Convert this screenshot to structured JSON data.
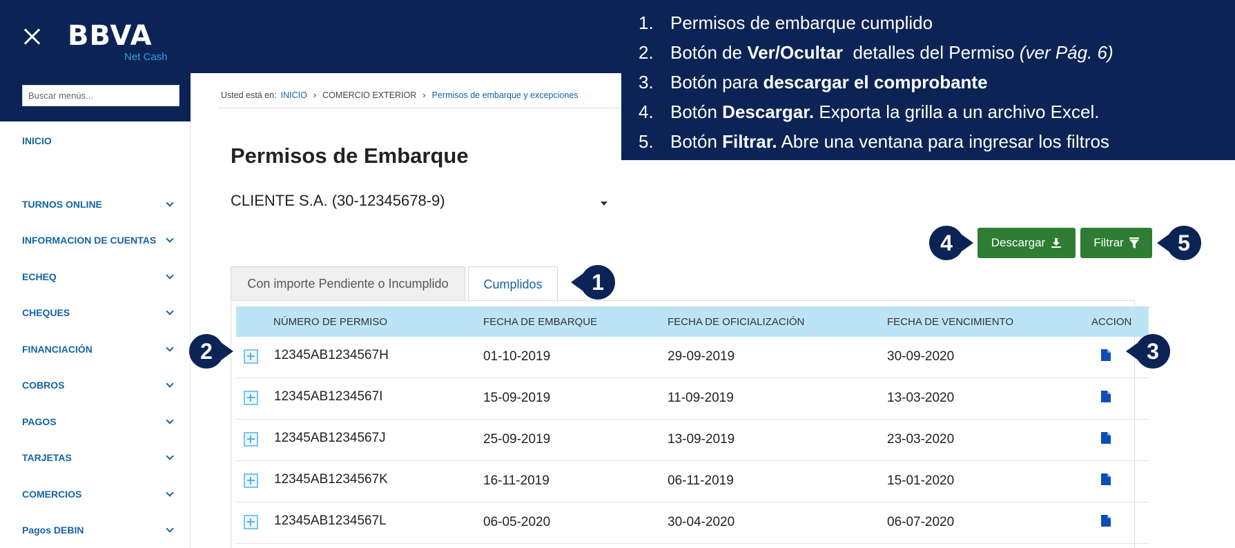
{
  "header": {
    "brand": "BBVA",
    "product": "Net Cash"
  },
  "sidebar": {
    "search_placeholder": "Buscar menús...",
    "home": "INICIO",
    "items": [
      {
        "label": "TURNOS ONLINE"
      },
      {
        "label": "INFORMACION DE CUENTAS"
      },
      {
        "label": "ECHEQ"
      },
      {
        "label": "CHEQUES"
      },
      {
        "label": "FINANCIACIÓN"
      },
      {
        "label": "COBROS"
      },
      {
        "label": "PAGOS"
      },
      {
        "label": "TARJETAS"
      },
      {
        "label": "COMERCIOS"
      },
      {
        "label": "Pagos DEBIN"
      }
    ]
  },
  "breadcrumb": {
    "prefix": "Usted está en:",
    "items": [
      "INICIO",
      "COMERCIO EXTERIOR",
      "Permisos de embarque y excepciones"
    ]
  },
  "page": {
    "title": "Permisos de Embarque",
    "client_selected": "CLIENTE S.A. (30-12345678-9)"
  },
  "toolbar": {
    "download_label": "Descargar",
    "filter_label": "Filtrar"
  },
  "tabs": [
    {
      "label": "Con importe Pendiente o Incumplido",
      "active": false
    },
    {
      "label": "Cumplidos",
      "active": true
    }
  ],
  "table": {
    "columns": [
      "NÚMERO DE PERMISO",
      "FECHA DE EMBARQUE",
      "FECHA DE OFICIALIZACIÓN",
      "FECHA DE VENCIMIENTO",
      "ACCION"
    ],
    "rows": [
      {
        "permit": "12345AB1234567H",
        "shipment": "01-10-2019",
        "official": "29-09-2019",
        "expiry": "30-09-2020"
      },
      {
        "permit": "12345AB1234567I",
        "shipment": "15-09-2019",
        "official": "11-09-2019",
        "expiry": "13-03-2020"
      },
      {
        "permit": "12345AB1234567J",
        "shipment": "25-09-2019",
        "official": "13-09-2019",
        "expiry": "23-03-2020"
      },
      {
        "permit": "12345AB1234567K",
        "shipment": "16-11-2019",
        "official": "06-11-2019",
        "expiry": "15-01-2020"
      },
      {
        "permit": "12345AB1234567L",
        "shipment": "06-05-2020",
        "official": "30-04-2020",
        "expiry": "06-07-2020"
      }
    ]
  },
  "annotations": {
    "callouts": [
      "1",
      "2",
      "3",
      "4",
      "5"
    ],
    "legend": [
      {
        "num": "1.",
        "text": "Permisos de embarque cumplido"
      },
      {
        "num": "2.",
        "pre": "Botón de ",
        "bold": "Ver/Ocultar",
        "post": "  detalles del Permiso ",
        "italic": "(ver Pág. 6)"
      },
      {
        "num": "3.",
        "pre": "Botón para ",
        "bold": "descargar el comprobante"
      },
      {
        "num": "4.",
        "pre": "Botón ",
        "bold": "Descargar.",
        "post": " Exporta la grilla a un archivo Excel."
      },
      {
        "num": "5.",
        "pre": "Botón ",
        "bold": "Filtrar.",
        "post": " Abre una ventana para ingresar los filtros"
      }
    ]
  },
  "colors": {
    "navy": "#0c2455",
    "link": "#1464a5",
    "green": "#2e7d32",
    "header_row": "#bde4f6"
  }
}
